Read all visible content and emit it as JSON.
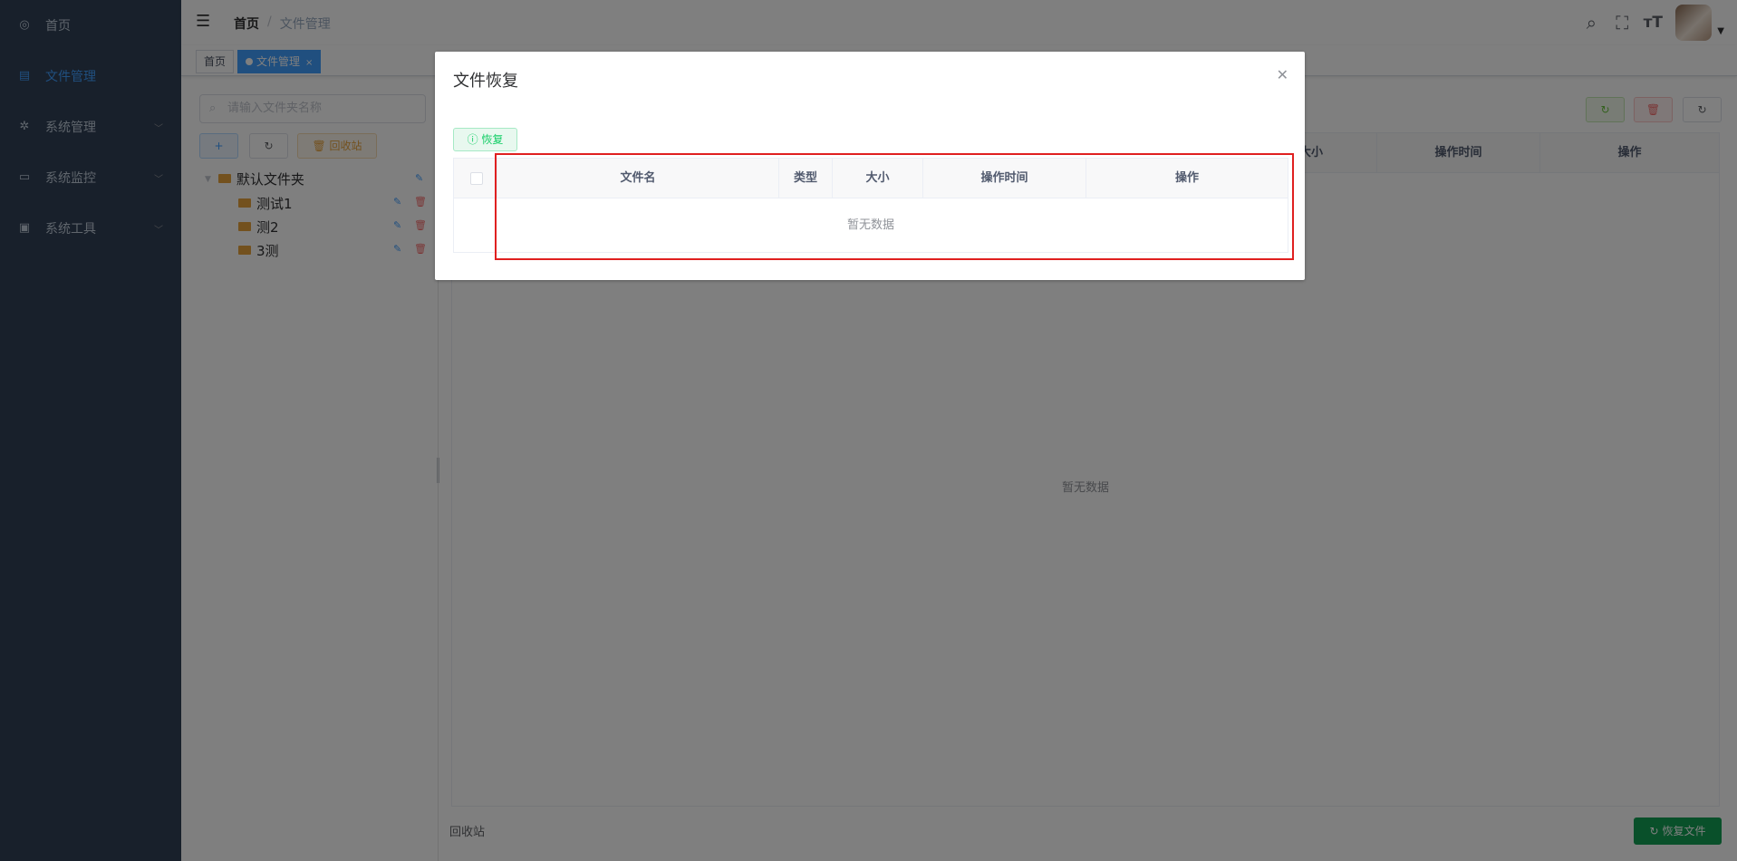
{
  "sidebar": {
    "items": [
      {
        "label": "首页",
        "icon": "dashboard-icon",
        "active": false
      },
      {
        "label": "文件管理",
        "icon": "document-icon",
        "active": true
      },
      {
        "label": "系统管理",
        "icon": "gear-icon",
        "active": false
      },
      {
        "label": "系统监控",
        "icon": "monitor-icon",
        "active": false
      },
      {
        "label": "系统工具",
        "icon": "toolbox-icon",
        "active": false
      }
    ]
  },
  "navbar": {
    "breadcrumb_home": "首页",
    "breadcrumb_sep": "/",
    "breadcrumb_current": "文件管理"
  },
  "tags": {
    "home": "首页",
    "current": "文件管理"
  },
  "tree_panel": {
    "search_placeholder": "请输入文件夹名称",
    "add_label": "+",
    "refresh_label": "↻",
    "recycle_label": "回收站",
    "nodes": {
      "root": "默认文件夹",
      "child1": "测试1",
      "child2": "测2",
      "child3": "3测"
    }
  },
  "main_table": {
    "columns": {
      "size": "大小",
      "op_time": "操作时间",
      "op": "操作"
    },
    "empty_text": "暂无数据",
    "footer_label": "回收站",
    "restore_files_label": "恢复文件"
  },
  "dialog": {
    "title": "文件恢复",
    "restore_label": "恢复",
    "columns": {
      "filename": "文件名",
      "type": "类型",
      "size": "大小",
      "op_time": "操作时间",
      "op": "操作"
    },
    "empty_text": "暂无数据"
  },
  "colors": {
    "sidebar_bg": "#304156",
    "accent": "#409eff",
    "highlight": "#e02020"
  }
}
